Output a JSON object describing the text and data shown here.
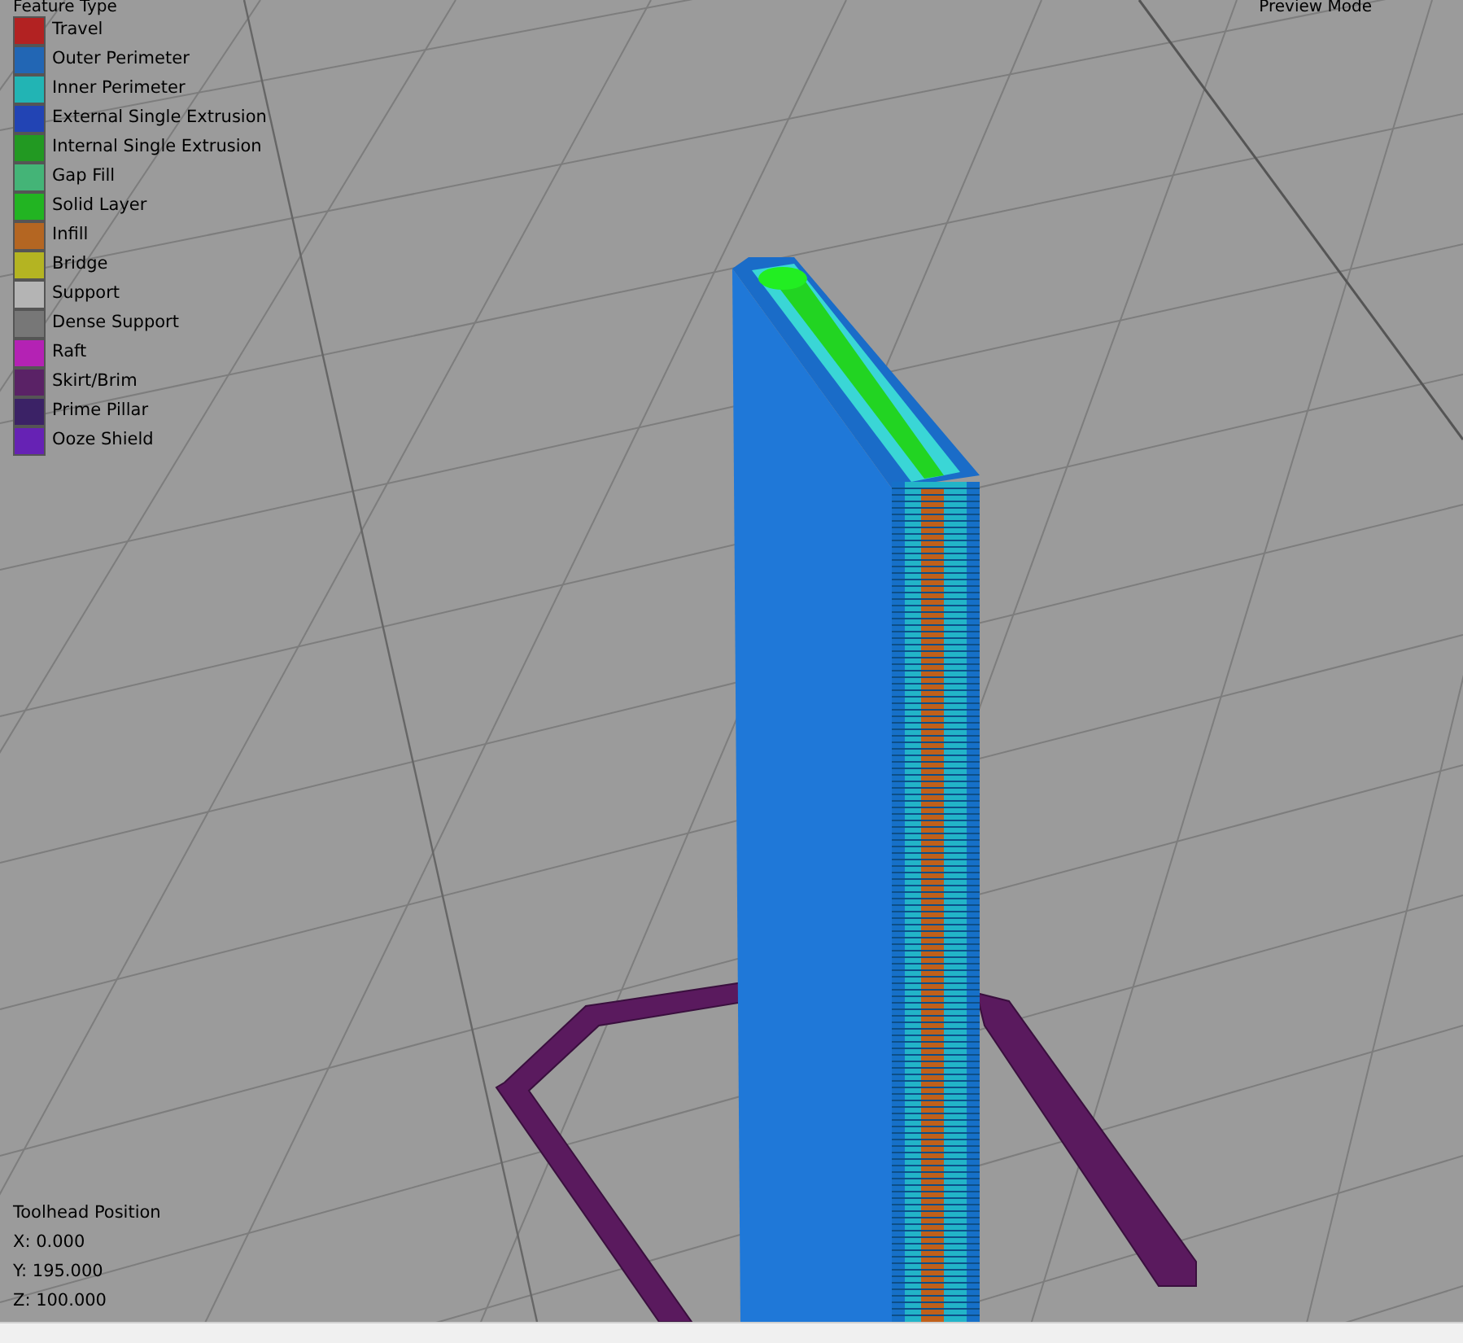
{
  "legend": {
    "title": "Feature Type",
    "items": [
      {
        "label": "Travel",
        "color": "#b22222"
      },
      {
        "label": "Outer Perimeter",
        "color": "#2266b4"
      },
      {
        "label": "Inner Perimeter",
        "color": "#22b4b4"
      },
      {
        "label": "External Single Extrusion",
        "color": "#2244b4"
      },
      {
        "label": "Internal Single Extrusion",
        "color": "#229922"
      },
      {
        "label": "Gap Fill",
        "color": "#44b477"
      },
      {
        "label": "Solid Layer",
        "color": "#22b422"
      },
      {
        "label": "Infill",
        "color": "#b46622"
      },
      {
        "label": "Bridge",
        "color": "#b4b422"
      },
      {
        "label": "Support",
        "color": "#b4b4b4"
      },
      {
        "label": "Dense Support",
        "color": "#777777"
      },
      {
        "label": "Raft",
        "color": "#b422b4"
      },
      {
        "label": "Skirt/Brim",
        "color": "#5a2266"
      },
      {
        "label": "Prime Pillar",
        "color": "#3b2266"
      },
      {
        "label": "Ooze Shield",
        "color": "#6622b4"
      }
    ]
  },
  "mode_label": "Preview Mode",
  "toolhead": {
    "title": "Toolhead Position",
    "lines": [
      "X: 0.000",
      "Y: 195.000",
      "Z: 100.000"
    ]
  }
}
